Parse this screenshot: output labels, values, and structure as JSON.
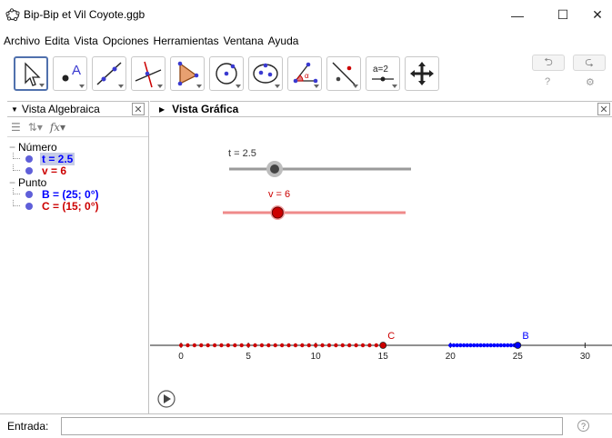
{
  "window": {
    "title": "Bip-Bip et Vil Coyote.ggb",
    "minimize": "—",
    "maximize": "☐",
    "close": "✕"
  },
  "menu": [
    "Archivo",
    "Edita",
    "Vista",
    "Opciones",
    "Herramientas",
    "Ventana",
    "Ayuda"
  ],
  "toolbar": {
    "tools": [
      "move-tool-icon",
      "point-tool-icon",
      "line-tool-icon",
      "perpendicular-line-tool-icon",
      "polygon-tool-icon",
      "circle-tool-icon",
      "ellipse-tool-icon",
      "angle-tool-icon",
      "reflect-tool-icon",
      "slider-tool-icon",
      "move-graphics-view-icon"
    ],
    "slider_tool_label": "a=2",
    "undo": "⮌",
    "redo": "⮎",
    "help": "?",
    "settings": "⚙"
  },
  "algebra": {
    "title": "Vista Algebraica",
    "close": "✕",
    "categories": [
      {
        "name": "Número",
        "items": [
          {
            "text": "t = 2.5",
            "color": "#0000ff",
            "selected": true
          },
          {
            "text": "v = 6",
            "color": "#cc0000",
            "selected": false
          }
        ]
      },
      {
        "name": "Punto",
        "items": [
          {
            "text": "B = (25; 0°)",
            "color": "#0000ff",
            "selected": false
          },
          {
            "text": "C = (15; 0°)",
            "color": "#cc0000",
            "selected": false
          }
        ]
      }
    ]
  },
  "graphics": {
    "title": "Vista Gráfica",
    "close": "✕",
    "slider_t": {
      "label": "t = 2.5",
      "value": 2.5,
      "min": 0,
      "max": 10,
      "color": "#555555"
    },
    "slider_v": {
      "label": "v = 6",
      "value": 6,
      "min": 0,
      "max": 20,
      "color": "#cc0000"
    },
    "axis": {
      "ticks": [
        "0",
        "5",
        "10",
        "15",
        "20",
        "25",
        "30"
      ],
      "min": -2.3,
      "max": 32
    },
    "point_B": {
      "label": "B",
      "x": 25,
      "trace_from": 20,
      "color": "#0000ff"
    },
    "point_C": {
      "label": "C",
      "x": 15,
      "trace_from": 0,
      "color": "#cc0000"
    },
    "play": "▶"
  },
  "input": {
    "label": "Entrada:",
    "placeholder": "",
    "help": "?"
  }
}
